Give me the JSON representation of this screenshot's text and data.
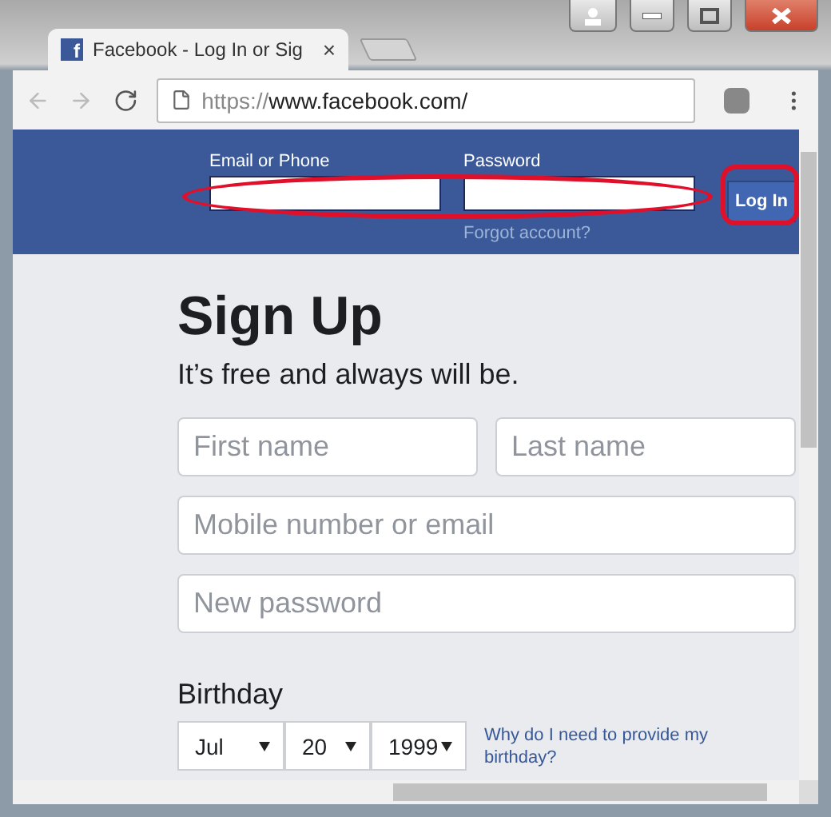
{
  "tab": {
    "favicon_letter": "f",
    "title": "Facebook - Log In or Sig",
    "close": "×",
    "selected": true
  },
  "address": {
    "scheme": "https://",
    "host": "www.facebook.com/"
  },
  "header": {
    "fields": [
      {
        "label": "Email or Phone"
      },
      {
        "label": "Password"
      }
    ],
    "forgot_link": "Forgot account?",
    "login_button": "Log In"
  },
  "signup": {
    "title": "Sign Up",
    "subtitle": "It’s free and always will be.",
    "name_fields": [
      {
        "placeholder": "First name"
      },
      {
        "placeholder": "Last name"
      }
    ],
    "contact_field": {
      "placeholder": "Mobile number or email"
    },
    "password_field": {
      "placeholder": "New password"
    },
    "birthday_label": "Birthday",
    "birthday_selects": [
      {
        "value": "Jul"
      },
      {
        "value": "20"
      },
      {
        "value": "1999"
      }
    ],
    "birthday_help": "Why do I need to provide my birthday?"
  }
}
